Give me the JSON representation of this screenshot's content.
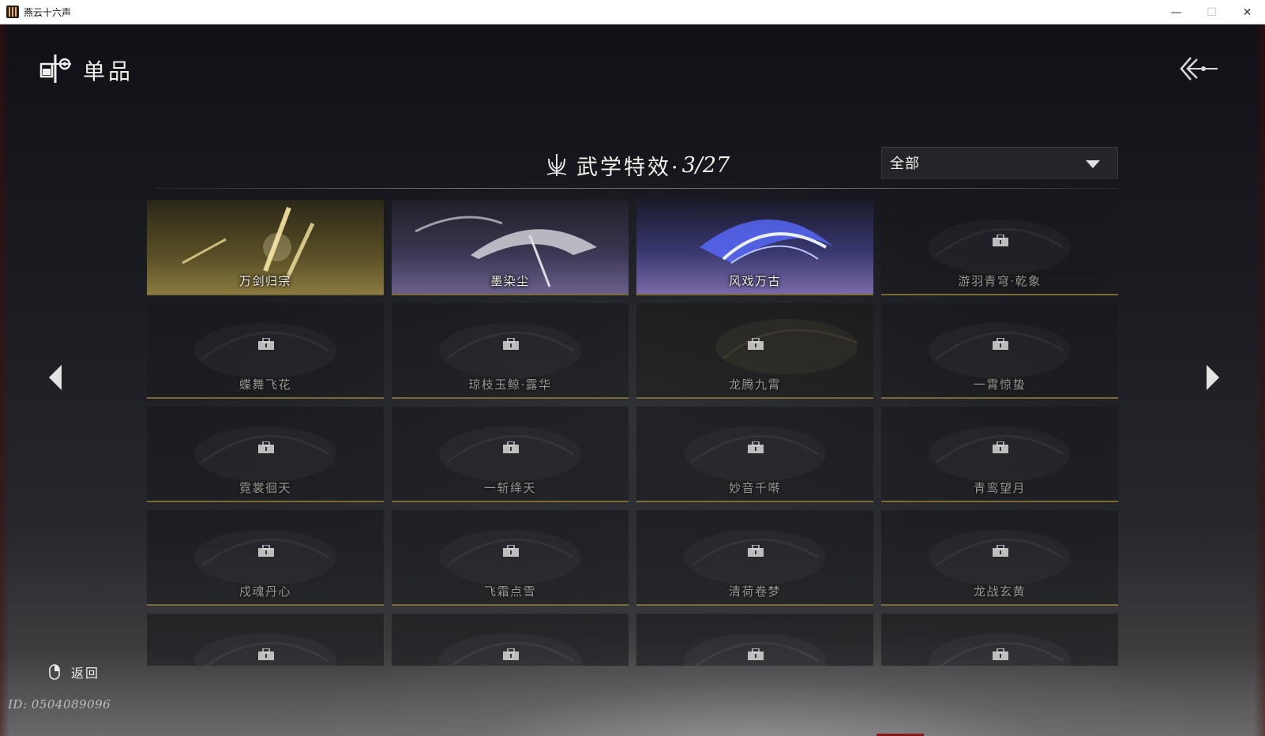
{
  "window": {
    "title": "燕云十六声",
    "icon": "game-app-icon",
    "controls": {
      "minimize": "—",
      "maximize": "☐",
      "close": "✕"
    }
  },
  "header": {
    "title": "单品",
    "icon": "item-category-icon",
    "back_icon": "return-arrow-icon"
  },
  "section": {
    "title": "武学特效·",
    "count": "3/27",
    "icon": "lotus-trident-icon"
  },
  "filter": {
    "selected": "全部"
  },
  "cards": [
    {
      "name": "万剑归宗",
      "locked": false,
      "theme": "gold"
    },
    {
      "name": "墨染尘",
      "locked": false,
      "theme": "purple"
    },
    {
      "name": "风戏万古",
      "locked": false,
      "theme": "blue"
    },
    {
      "name": "游羽青穹·乾象",
      "locked": true,
      "theme": "dark"
    },
    {
      "name": "蝶舞飞花",
      "locked": true,
      "theme": "dark"
    },
    {
      "name": "琼枝玉鲸·露华",
      "locked": true,
      "theme": "dark"
    },
    {
      "name": "龙腾九霄",
      "locked": true,
      "theme": "dark-gold"
    },
    {
      "name": "一霄惊蛰",
      "locked": true,
      "theme": "dark"
    },
    {
      "name": "霓裳徊天",
      "locked": true,
      "theme": "dark"
    },
    {
      "name": "一斩绛天",
      "locked": true,
      "theme": "dark"
    },
    {
      "name": "妙音千啭",
      "locked": true,
      "theme": "dark"
    },
    {
      "name": "青鸾望月",
      "locked": true,
      "theme": "dark"
    },
    {
      "name": "戍魂丹心",
      "locked": true,
      "theme": "dark"
    },
    {
      "name": "飞霜点雪",
      "locked": true,
      "theme": "dark"
    },
    {
      "name": "清荷卷梦",
      "locked": true,
      "theme": "dark"
    },
    {
      "name": "龙战玄黄",
      "locked": true,
      "theme": "dark"
    },
    {
      "name": "",
      "locked": true,
      "theme": "dark"
    },
    {
      "name": "",
      "locked": true,
      "theme": "dark"
    },
    {
      "name": "",
      "locked": true,
      "theme": "dark"
    },
    {
      "name": "",
      "locked": true,
      "theme": "dark"
    }
  ],
  "footer": {
    "back_label": "返回",
    "mouse_icon": "mouse-right-click-icon",
    "uid": "ID: 0504089096"
  },
  "colors": {
    "accent_gold": "#8a7a40",
    "text_light": "#f2f0ea",
    "locked_text": "#9a9894"
  }
}
